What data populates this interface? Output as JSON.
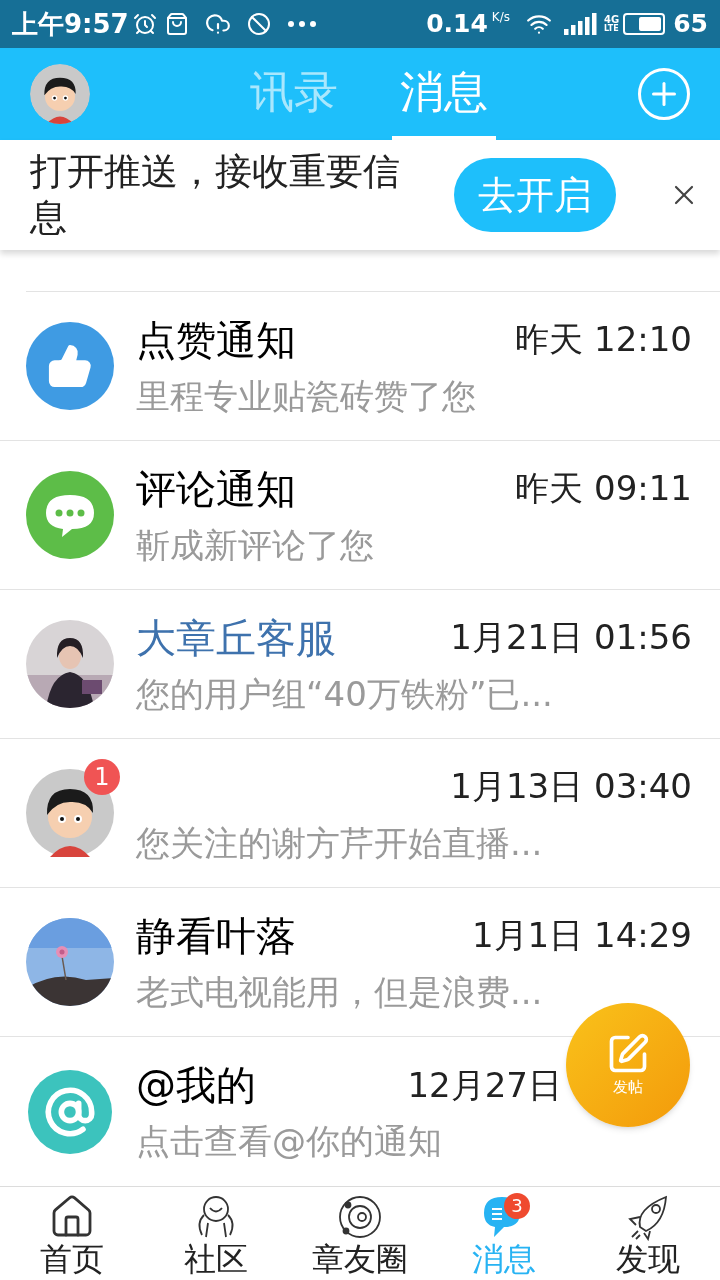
{
  "status_bar": {
    "time": "上午9:57",
    "speed": "0.14",
    "speed_unit": "K/s",
    "network": "4G",
    "network_sub": "LTE",
    "battery": "65"
  },
  "header": {
    "tabs": [
      {
        "label": "讯录",
        "selected": false
      },
      {
        "label": "消息",
        "selected": true
      }
    ]
  },
  "push_banner": {
    "text": "打开推送，接收重要信息",
    "button": "去开启"
  },
  "messages": [
    {
      "kind": "like",
      "name": "点赞通知",
      "highlight": false,
      "time": "昨天 12:10",
      "preview": "里程专业贴瓷砖赞了您"
    },
    {
      "kind": "comment",
      "name": "评论通知",
      "highlight": false,
      "time": "昨天 09:11",
      "preview": "靳成新评论了您"
    },
    {
      "name": "大章丘客服",
      "highlight": true,
      "time": "1月21日 01:56",
      "preview": "您的用户组“40万铁粉”已..."
    },
    {
      "kind": "cartoon",
      "badge": "1",
      "time": "1月13日 03:40",
      "preview": "您关注的谢方芹开始直播..."
    },
    {
      "name": "静看叶落",
      "highlight": false,
      "time": "1月1日 14:29",
      "preview": "老式电视能用，但是浪费..."
    },
    {
      "kind": "mention",
      "name": "@我的",
      "highlight": false,
      "time": "12月27日",
      "preview": "点击查看@你的通知"
    }
  ],
  "fab": {
    "label": "发帖"
  },
  "bottom_nav": [
    {
      "kind": "home",
      "label": "首页",
      "selected": false
    },
    {
      "kind": "community",
      "label": "社区",
      "selected": false
    },
    {
      "kind": "circle",
      "label": "章友圈",
      "selected": false
    },
    {
      "kind": "message",
      "label": "消息",
      "selected": true,
      "badge": "3"
    },
    {
      "kind": "discover",
      "label": "发现",
      "selected": false
    }
  ]
}
